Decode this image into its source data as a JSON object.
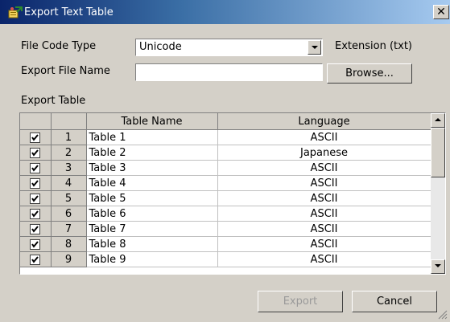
{
  "window": {
    "title": "Export Text Table",
    "close_glyph": "✕"
  },
  "form": {
    "file_code_type_label": "File Code Type",
    "file_code_type_value": "Unicode",
    "extension_label": "Extension (txt)",
    "export_file_name_label": "Export File Name",
    "export_file_name_value": "",
    "browse_label": "Browse...",
    "export_table_label": "Export Table"
  },
  "table": {
    "columns": [
      "",
      "",
      "Table Name",
      "Language"
    ],
    "rows": [
      {
        "checked": true,
        "num": "1",
        "name": "Table 1",
        "language": "ASCII"
      },
      {
        "checked": true,
        "num": "2",
        "name": "Table 2",
        "language": "Japanese"
      },
      {
        "checked": true,
        "num": "3",
        "name": "Table 3",
        "language": "ASCII"
      },
      {
        "checked": true,
        "num": "4",
        "name": "Table 4",
        "language": "ASCII"
      },
      {
        "checked": true,
        "num": "5",
        "name": "Table 5",
        "language": "ASCII"
      },
      {
        "checked": true,
        "num": "6",
        "name": "Table 6",
        "language": "ASCII"
      },
      {
        "checked": true,
        "num": "7",
        "name": "Table 7",
        "language": "ASCII"
      },
      {
        "checked": true,
        "num": "8",
        "name": "Table 8",
        "language": "ASCII"
      },
      {
        "checked": true,
        "num": "9",
        "name": "Table 9",
        "language": "ASCII"
      }
    ]
  },
  "buttons": {
    "export_label": "Export",
    "export_enabled": false,
    "cancel_label": "Cancel"
  },
  "colors": {
    "title_bar_start": "#0a246a",
    "title_bar_end": "#a6caf0",
    "dialog_bg": "#d4d0c8"
  }
}
